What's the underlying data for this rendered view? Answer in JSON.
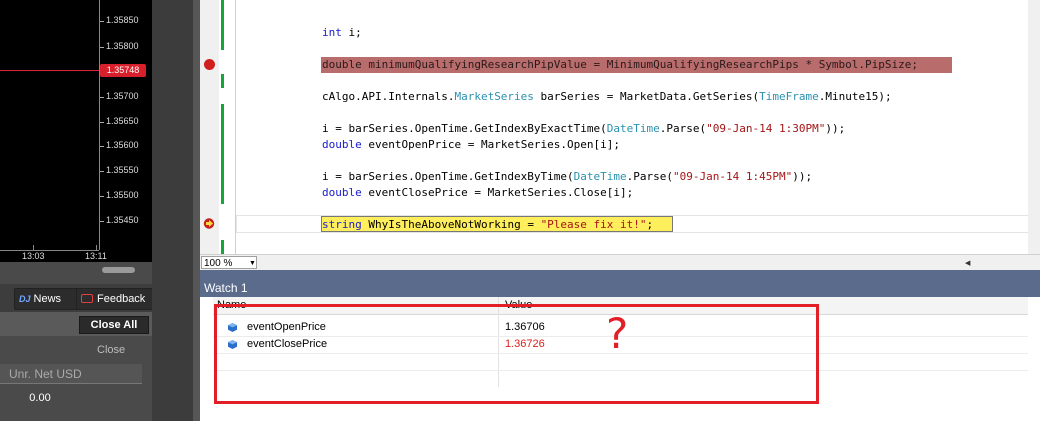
{
  "chart": {
    "price_labels": [
      "1.35850",
      "1.35800",
      "1.35700",
      "1.35650",
      "1.35600",
      "1.35550",
      "1.35500",
      "1.35450"
    ],
    "current_price": "1.35748",
    "time_labels": [
      "13:03",
      "13:11"
    ],
    "line_color": "#e0203a"
  },
  "panel": {
    "news_label": "News",
    "news_brand": "DJ",
    "feedback_label": "Feedback",
    "close_all_label": "Close All",
    "close_label": "Close",
    "unr_placeholder": "Unr. Net USD",
    "unr_value": "0.00"
  },
  "editor": {
    "line1": {
      "kw": "int",
      "rest": " i;"
    },
    "line2": "double minimumQualifyingResearchPipValue = MinimumQualifyingResearchPips * Symbol.PipSize;",
    "line3": {
      "a": "cAlgo.API.Internals.",
      "t1": "MarketSeries",
      "b": " barSeries = MarketData.GetSeries(",
      "t2": "TimeFrame",
      "c": ".Minute15);"
    },
    "line4": {
      "a": "i = barSeries.OpenTime.GetIndexByExactTime(",
      "t": "DateTime",
      "b": ".Parse(",
      "s": "\"09-Jan-14 1:30PM\"",
      "c": "));"
    },
    "line5": {
      "kw": "double",
      "rest": " eventOpenPrice = MarketSeries.Open[i];"
    },
    "line6": {
      "a": "i = barSeries.OpenTime.GetIndexByTime(",
      "t": "DateTime",
      "b": ".Parse(",
      "s": "\"09-Jan-14 1:45PM\"",
      "c": "));"
    },
    "line7": {
      "kw": "double",
      "rest": " eventClosePrice = MarketSeries.Close[i];"
    },
    "line8": {
      "kw": "string",
      "a": " WhyIsTheAboveNotWorking = ",
      "s": "\"Please fix it!\"",
      "c": ";"
    },
    "accent_breakpoint": "#b86c6c",
    "accent_current": "#ffef5c"
  },
  "zoom": {
    "value": "100 %"
  },
  "watch": {
    "title": "Watch 1",
    "columns": [
      "Name",
      "Value"
    ],
    "rows": [
      {
        "name": "eventOpenPrice",
        "value": "1.36706",
        "changed": false
      },
      {
        "name": "eventClosePrice",
        "value": "1.36726",
        "changed": true
      }
    ],
    "annotation": "?"
  }
}
